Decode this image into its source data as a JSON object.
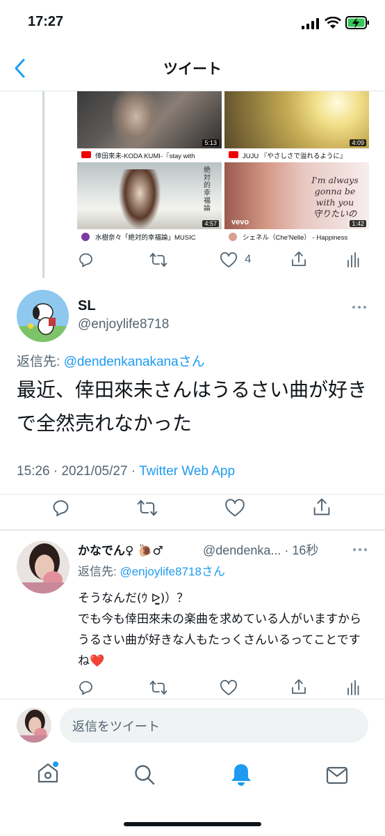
{
  "status": {
    "time": "17:27"
  },
  "header": {
    "title": "ツイート"
  },
  "videos": [
    {
      "title": "倖田來未-KODA KUMI-『stay with",
      "duration": "5:13"
    },
    {
      "title": "JUJU 『やさしさで溢れるように』",
      "duration": "4:09"
    },
    {
      "title": "水樹奈々「絶対的幸福論」MUSIC",
      "duration": "4:57"
    },
    {
      "title": "シェネル（Che'Nelle） - Happiness",
      "duration": "1:42"
    }
  ],
  "video_overlays": {
    "v3_art": "絶対的幸福論",
    "v4_lines": [
      "I'm always",
      "gonna be",
      "with you",
      "守りたいの"
    ],
    "vevo": "vevo"
  },
  "top_actions": {
    "like_count": "4"
  },
  "main_tweet": {
    "name": "SL",
    "handle": "@enjoylife8718",
    "reply_label": "返信先: ",
    "reply_to": "@dendenkanakanaさん",
    "text": "最近、倖田來未さんはうるさい曲が好きで全然売れなかった",
    "time": "15:26 · 2021/05/27 · ",
    "source": "Twitter Web App"
  },
  "reply_tweet": {
    "name": "かなでん♀ 🐌♂",
    "handle": "@dendenka... · 16秒",
    "reply_label": "返信先: ",
    "reply_to": "@enjoylife8718さん",
    "line1": "そうなんだ(ｳ ᐅ̤̫)）？",
    "line2": "でも今も倖田來未の楽曲を求めている人がいますからうるさい曲が好きな人もたっくさんいるってことですね❤️"
  },
  "compose": {
    "placeholder": "返信をツイート"
  },
  "colors": {
    "accent": "#1d9bf0",
    "gray": "#536471"
  }
}
